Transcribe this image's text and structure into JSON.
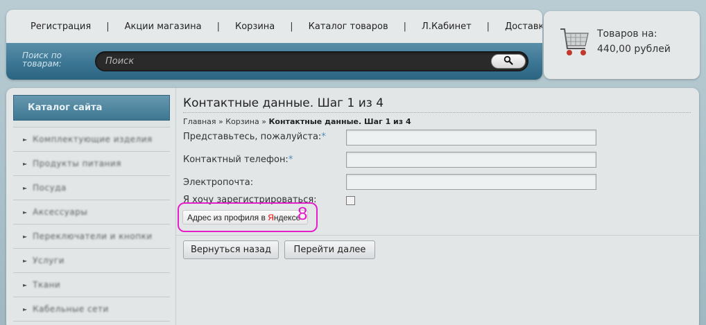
{
  "nav": {
    "items": [
      "Регистрация",
      "Акции магазина",
      "Корзина",
      "Каталог товаров",
      "Л.Кабинет",
      "Доставка"
    ],
    "separator": "|"
  },
  "search": {
    "label": "Поиск по товарам:",
    "placeholder": "Поиск"
  },
  "cart": {
    "title": "Товаров на:",
    "amount": "440,00 рублей"
  },
  "sidebar": {
    "title": "Каталог сайта",
    "items": [
      "Комплектующие изделия",
      "Продукты питания",
      "Посуда",
      "Аксессуары",
      "Переключатели и кнопки",
      "Услуги",
      "Ткани",
      "Кабельные сети"
    ]
  },
  "page": {
    "title": "Контактные данные. Шаг 1 из 4",
    "breadcrumb": {
      "home": "Главная",
      "cart": "Корзина",
      "sep": "»",
      "current": "Контактные данные. Шаг 1 из 4"
    }
  },
  "form": {
    "name_label": "Представьтесь, пожалуйста:",
    "phone_label": "Контактный телефон:",
    "email_label": "Электропочта:",
    "register_label": "Я хочу зарегистрироваться:",
    "required_mark": "*",
    "yandex_prefix": "Адрес из профиля в ",
    "yandex_brand_first": "Я",
    "yandex_brand_rest": "ндексе",
    "annotation": "8",
    "back_button": "Вернуться назад",
    "next_button": "Перейти далее"
  },
  "colors": {
    "accent": "#3d7896",
    "highlight": "#e31ec9"
  }
}
